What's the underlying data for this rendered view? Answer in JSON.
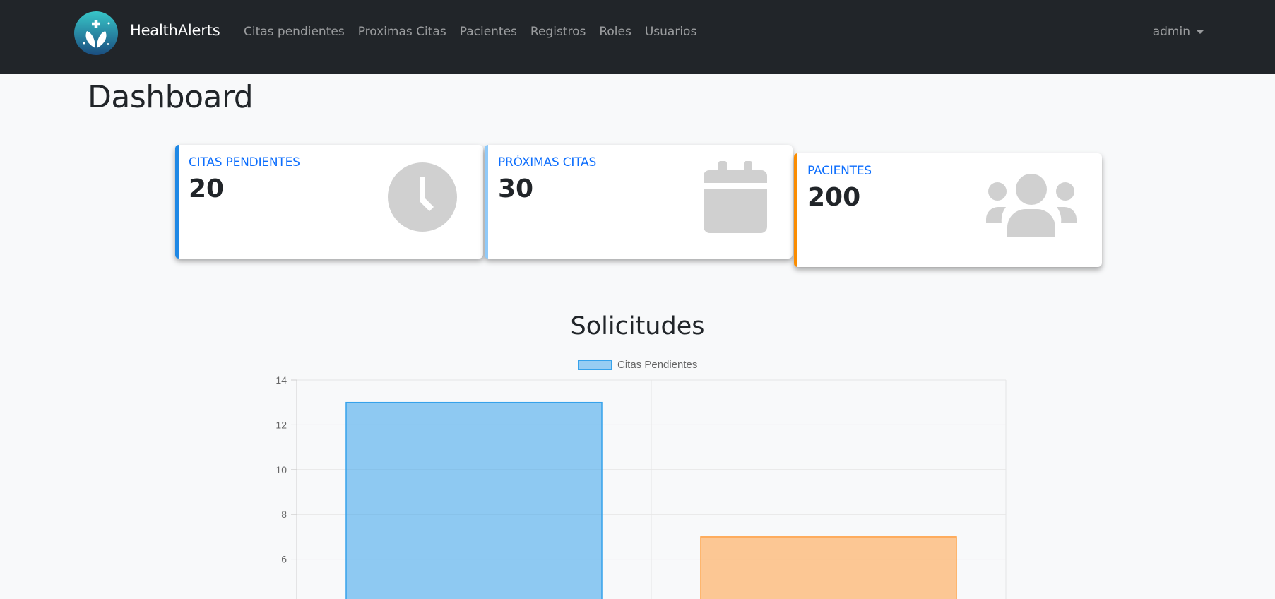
{
  "navbar": {
    "brand": "HealthAlerts",
    "links": [
      "Citas pendientes",
      "Proximas Citas",
      "Pacientes",
      "Registros",
      "Roles",
      "Usuarios"
    ],
    "user": "admin"
  },
  "page": {
    "title": "Dashboard"
  },
  "cards": [
    {
      "label": "CITAS PENDIENTES",
      "value": "20",
      "icon": "clock-icon",
      "accent": "#1e88e5"
    },
    {
      "label": "PRÓXIMAS CITAS",
      "value": "30",
      "icon": "calendar-icon",
      "accent": "#90caf9"
    },
    {
      "label": "PACIENTES",
      "value": "200",
      "icon": "users-icon",
      "accent": "#fb8c00"
    }
  ],
  "chart_title": "Solicitudes",
  "chart_data": {
    "type": "bar",
    "categories": [
      "",
      ""
    ],
    "series": [
      {
        "name": "Citas Pendientes",
        "values": [
          13,
          7
        ]
      }
    ],
    "bar_colors": [
      "#36a2eb",
      "#ff9f40"
    ],
    "ylim": [
      0,
      14
    ],
    "yticks": [
      14,
      12,
      10,
      8,
      6
    ],
    "grid": true,
    "legend": "top"
  }
}
